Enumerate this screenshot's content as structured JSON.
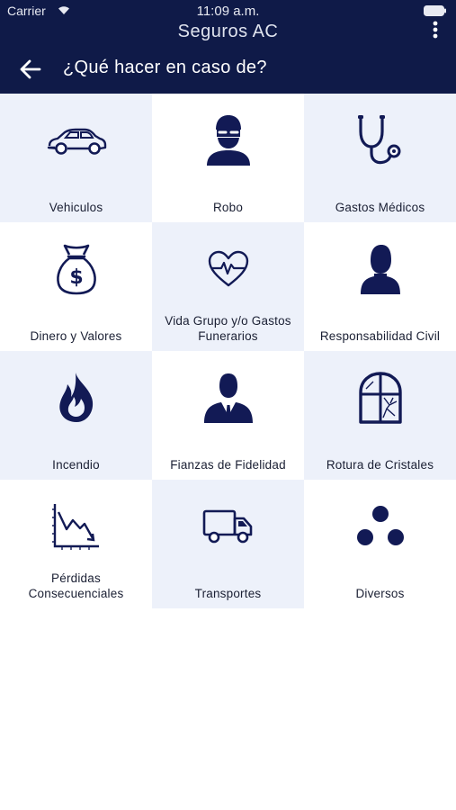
{
  "status_bar": {
    "carrier": "Carrier",
    "time": "11:09 a.m."
  },
  "app_title": "Seguros AC",
  "nav": {
    "title": "¿Qué hacer en caso de?"
  },
  "colors": {
    "header_bg": "#0f1a48",
    "icon": "#121a55",
    "tile_light": "#edf1fa"
  },
  "tiles": [
    {
      "label": "Vehiculos",
      "icon": "car-icon"
    },
    {
      "label": "Robo",
      "icon": "thief-icon"
    },
    {
      "label": "Gastos Médicos",
      "icon": "stethoscope-icon"
    },
    {
      "label": "Dinero y Valores",
      "icon": "money-bag-icon"
    },
    {
      "label": "Vida Grupo y/o Gastos Funerarios",
      "icon": "heartbeat-icon"
    },
    {
      "label": "Responsabilidad Civil",
      "icon": "person-icon"
    },
    {
      "label": "Incendio",
      "icon": "fire-icon"
    },
    {
      "label": "Fianzas de Fidelidad",
      "icon": "businessman-icon"
    },
    {
      "label": "Rotura de Cristales",
      "icon": "broken-window-icon"
    },
    {
      "label": "Pérdidas Consecuenciales",
      "icon": "chart-down-icon"
    },
    {
      "label": "Transportes",
      "icon": "truck-icon"
    },
    {
      "label": "Diversos",
      "icon": "dots-icon"
    }
  ]
}
